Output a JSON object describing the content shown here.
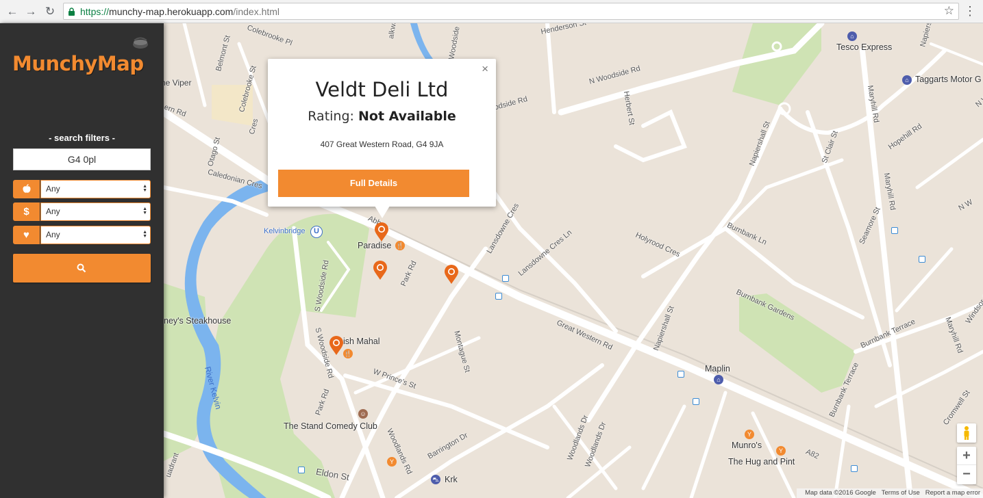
{
  "browser": {
    "url_protocol": "https://",
    "url_host": "munchy-map.herokuapp.com",
    "url_path": "/index.html"
  },
  "sidebar": {
    "logo": "MunchyMap",
    "filters_title": "- search filters -",
    "location_value": "G4 0pl",
    "filters": [
      {
        "icon": "apple-icon",
        "value": "Any"
      },
      {
        "icon": "dollar-icon",
        "value": "Any"
      },
      {
        "icon": "heart-icon",
        "value": "Any"
      }
    ],
    "accent_color": "#f28a30"
  },
  "infowindow": {
    "title": "Veldt Deli Ltd",
    "rating_label": "Rating:",
    "rating_value": "Not Available",
    "address": "407 Great Western Road, G4 9JA",
    "button_label": "Full Details",
    "close_glyph": "×"
  },
  "map": {
    "labels": {
      "paradise": "Paradise",
      "ish_mahal": "ish Mahal",
      "kelvinbridge": "Kelvinbridge",
      "steakhouse": "ney's Steakhouse",
      "stand": "The Stand Comedy Club",
      "krk": "Krk",
      "tesco": "Tesco Express",
      "taggarts": "Taggarts Motor G",
      "maplin": "Maplin",
      "munros": "Munro's",
      "hug": "The Hug and Pint",
      "viper": "he Viper",
      "river_kelvin": "River Kelvin",
      "great_western": "Great Western Rd",
      "n_woodside": "N Woodside Rd",
      "woodside_rd": "oodside Rd",
      "eldon": "Eldon St",
      "barrington": "Barrington Dr",
      "w_princes": "W Prince's St",
      "montague": "Montague St",
      "park_rd": "Park Rd",
      "park_rd2": "Park Rd",
      "s_woodside": "S Woodside Rd",
      "s_woodside2": "S Woodside Rd",
      "caledonian": "Caledonian Cres",
      "lansdowne": "Lansdowne Cres",
      "lansdowne_ln": "Lansdowne Cres Ln",
      "holyrood": "Holyrood Cres",
      "burnbank_ln": "Burnbank Ln",
      "burnbank_gardens": "Burnbank Gardens",
      "burnbank_terrace": "Burnbank Terrace",
      "burnbank_terrace2": "Burnbank Terrace",
      "napiershall": "Napiershall St",
      "napiershall2": "Napiershall St",
      "maryhill": "Maryhill Rd",
      "maryhill2": "Maryhill Rd",
      "herbert": "Herbert St",
      "henderson": "Henderson St",
      "st_clair": "St Clair St",
      "seamore": "Seamore St",
      "hopehill": "Hopehill Rd",
      "windsor": "Windsor St",
      "cromwell": "Cromwell St",
      "woodlands": "Woodlands Rd",
      "woodlands_dr": "Woodlands Dr",
      "woodlands_dr2": "Woodlands Dr",
      "a82": "A82",
      "colebrooke": "Colebrooke St",
      "colebrooke_pl": "Colebrooke Pl",
      "belmont": "Belmont St",
      "otago": "Otago St",
      "glasgow_st": "ern Rd",
      "s_woodside_top": "S Woodside",
      "alkway": "alkway",
      "n_w": "N W",
      "napiers": "Napiers",
      "quadrant": "uadrant",
      "n_woodside_right": "N Woodside Rd",
      "abb": "Abb",
      "cres": "Cres"
    },
    "attribution": "Map data ©2016 Google",
    "terms": "Terms of Use",
    "report": "Report a map error",
    "zoom_in": "+",
    "zoom_out": "−"
  }
}
